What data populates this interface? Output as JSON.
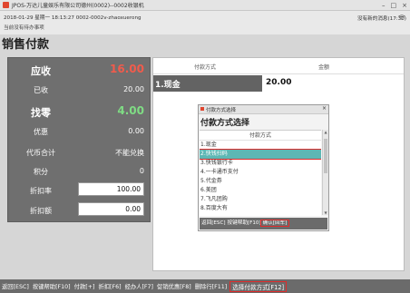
{
  "window": {
    "title": "JPOS-万达儿童娱乐有限公司德州(0002)--0002收银机"
  },
  "header": {
    "info_line": "2018-01-29 星期一 18:13:27  0002-0002v-zhaoxuerong",
    "status_line": "当前没有待办事项",
    "right_status": "没有新的消息(17:30)"
  },
  "page": {
    "title": "销售付款"
  },
  "summary": {
    "receivable_label": "应收",
    "receivable_value": "16.00",
    "received_label": "已收",
    "received_value": "20.00",
    "change_label": "找零",
    "change_value": "4.00",
    "discount_label": "优惠",
    "discount_value": "0.00",
    "voucher_label": "代币合计",
    "voucher_value": "不能兑换",
    "points_label": "积分",
    "points_value": "0",
    "rate_label": "折扣率",
    "rate_value": "100.00",
    "amount_label": "折扣额",
    "amount_value": "0.00"
  },
  "payments": {
    "col_method": "付款方式",
    "col_amount": "金额",
    "rows": [
      {
        "method": "1.现金",
        "amount": "20.00"
      }
    ]
  },
  "dialog": {
    "window_title": "付款方式选择",
    "title": "付款方式选择",
    "column": "付款方式",
    "items": [
      "1.现金",
      "2.快钱扫码",
      "3.快钱银行卡",
      "4.一卡通币支付",
      "5.代金券",
      "6.美团",
      "7.飞凡团购",
      "8.百度大有"
    ],
    "selected_index": 1,
    "footer_back": "返回[ESC]",
    "footer_help": "按键帮助[F10]",
    "footer_confirm": "确认[回车]"
  },
  "bottom_bar": {
    "keys": [
      "返回[ESC]",
      "按键帮助[F10]",
      "付款[+]",
      "折扣[F6]",
      "经办人[F7]",
      "促销优惠[F8]",
      "删除行[F11]"
    ],
    "highlight": "选择付款方式[F12]"
  },
  "colors": {
    "accent_red": "#e02b2b",
    "selection": "#5db7b4",
    "panel": "#6f6f6f"
  }
}
